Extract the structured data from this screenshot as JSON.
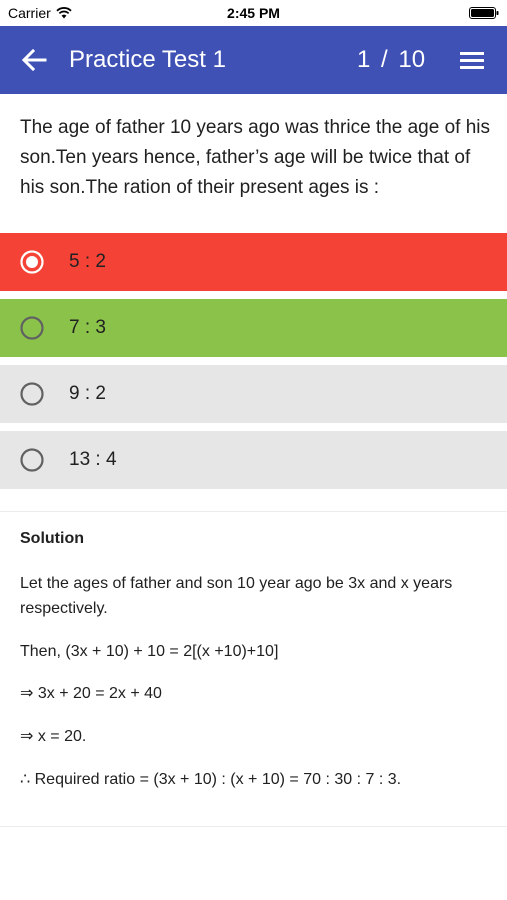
{
  "status_bar": {
    "carrier": "Carrier",
    "time": "2:45 PM",
    "wifi_icon": "wifi-icon",
    "battery_icon": "battery-icon"
  },
  "app_bar": {
    "title": "Practice Test 1",
    "counter": "1 / 10",
    "background": "#3f51b5",
    "back_icon": "arrow-left-icon",
    "menu_icon": "menu-icon"
  },
  "question": {
    "text": "The age of father 10 years ago was thrice the age of his son.Ten years hence, father’s age will be twice that of his son.The ration of their present ages is :"
  },
  "options": [
    {
      "label": "5 : 2",
      "state": "selected-incorrect",
      "color": "#f44336"
    },
    {
      "label": "7 : 3",
      "state": "correct",
      "color": "#8bc34a"
    },
    {
      "label": "9 : 2",
      "state": "unselected",
      "color": "#e6e6e6"
    },
    {
      "label": "13 : 4",
      "state": "unselected",
      "color": "#e6e6e6"
    }
  ],
  "solution": {
    "heading": "Solution",
    "lines": [
      "Let the ages of father and son 10 year ago be 3x and x years respectively.",
      "Then, (3x + 10) + 10 = 2[(x +10)+10]",
      "⇒ 3x + 20 = 2x + 40",
      "⇒ x = 20.",
      "∴ Required ratio = (3x + 10) : (x + 10) = 70 : 30 : 7 : 3."
    ]
  }
}
